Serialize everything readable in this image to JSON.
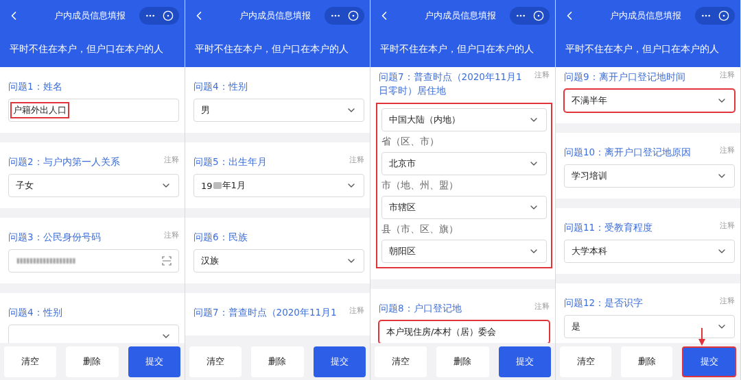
{
  "panels": [
    {
      "title": "户内成员信息填报",
      "subtitle": "平时不住在本户，但户口在本户的人",
      "scrolled": false,
      "questions": [
        {
          "kind": "text",
          "label": "问题1：姓名",
          "value": "户籍外出人口",
          "highlighted": true
        },
        {
          "kind": "select",
          "label": "问题2：与户内第一人关系",
          "note": "注释",
          "value": "子女",
          "highlighted": false
        },
        {
          "kind": "id",
          "label": "问题3：公民身份号码",
          "note": "注释",
          "highlighted": false
        },
        {
          "kind": "select",
          "label": "问题4：性别",
          "highlighted": false
        }
      ],
      "buttons": [
        {
          "label": "清空",
          "kind": "plain",
          "highlighted": false
        },
        {
          "label": "删除",
          "kind": "plain",
          "highlighted": false
        },
        {
          "label": "提交",
          "kind": "primary",
          "highlighted": false
        }
      ]
    },
    {
      "title": "户内成员信息填报",
      "subtitle": "平时不住在本户，但户口在本户的人",
      "scrolled": false,
      "questions": [
        {
          "kind": "select",
          "label": "问题4：性别",
          "value": "男",
          "highlighted": false
        },
        {
          "kind": "select",
          "label": "问题5：出生年月",
          "note": "注释",
          "value_parts": [
            "19",
            "年1月"
          ],
          "highlighted": false
        },
        {
          "kind": "select",
          "label": "问题6：民族",
          "value": "汉族",
          "highlighted": false
        },
        {
          "kind": "label",
          "label": "问题7：普查时点（2020年11月1",
          "note": "注释"
        }
      ],
      "buttons": [
        {
          "label": "清空",
          "kind": "plain",
          "highlighted": false
        },
        {
          "label": "删除",
          "kind": "plain",
          "highlighted": false
        },
        {
          "label": "提交",
          "kind": "primary",
          "highlighted": false
        }
      ]
    },
    {
      "title": "户内成员信息填报",
      "subtitle": "平时不住在本户，但户口在本户的人",
      "scrolled": true,
      "questions": [
        {
          "kind": "address",
          "label": "问题7：普查时点（2020年11月1日零时）居住地",
          "note": "注释",
          "highlighted": true,
          "fields": [
            {
              "value": "中国大陆（内地）"
            },
            {
              "caption": "省（区、市）",
              "value": "北京市"
            },
            {
              "caption": "市（地、州、盟）",
              "value": "市辖区"
            },
            {
              "caption": "县（市、区、旗）",
              "value": "朝阳区"
            }
          ]
        },
        {
          "kind": "field",
          "label": "问题8：户口登记地",
          "note": "注释",
          "value": "本户现住房/本村（居）委会",
          "highlighted": true
        }
      ],
      "buttons": [
        {
          "label": "清空",
          "kind": "plain",
          "highlighted": false
        },
        {
          "label": "删除",
          "kind": "plain",
          "highlighted": false
        },
        {
          "label": "提交",
          "kind": "primary",
          "highlighted": false
        }
      ]
    },
    {
      "title": "户内成员信息填报",
      "subtitle": "平时不住在本户，但户口在本户的人",
      "scrolled": true,
      "questions": [
        {
          "kind": "select",
          "label": "问题9：离开户口登记地时间",
          "note": "注释",
          "value": "不满半年",
          "highlighted": true
        },
        {
          "kind": "select",
          "label": "问题10：离开户口登记地原因",
          "note": "注释",
          "value": "学习培训",
          "highlighted": false
        },
        {
          "kind": "select",
          "label": "问题11：受教育程度",
          "note": "注释",
          "value": "大学本科",
          "highlighted": false
        },
        {
          "kind": "select",
          "label": "问题12：是否识字",
          "note": "注释",
          "value": "是",
          "highlighted": false
        }
      ],
      "buttons": [
        {
          "label": "清空",
          "kind": "plain",
          "highlighted": false
        },
        {
          "label": "删除",
          "kind": "plain",
          "highlighted": false
        },
        {
          "label": "提交",
          "kind": "primary",
          "highlighted": true
        }
      ]
    }
  ]
}
